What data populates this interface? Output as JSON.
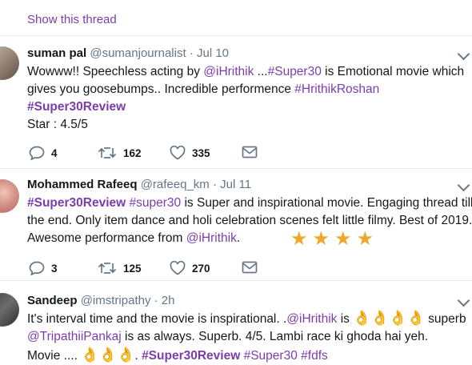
{
  "show_thread": "Show this thread",
  "tweets": [
    {
      "name": "suman pal",
      "handle": "@sumanjournalist",
      "sep": "·",
      "time": "Jul 10",
      "line1_a": "Wowww!! Speechless acting by ",
      "line1_mention": "@iHrithik",
      "line1_b": " ...",
      "line1_tag": "#Super30",
      "line1_c": " is Emotional movie which",
      "line2_a": "gives you goosebumps.. Incredible performence ",
      "line2_tag": "#HrithikRoshan",
      "line3_tag": "#Super30Review",
      "line4": "Star : 4.5/5",
      "replies": "4",
      "retweets": "162",
      "likes": "335"
    },
    {
      "name": "Mohammed Rafeeq",
      "handle": "@rafeeq_km",
      "sep": "·",
      "time": "Jul 11",
      "line1_tag1": "#Super30Review",
      "line1_tag2": "#super30",
      "line1_b": " is Super and inspirational movie. Engaging thread till",
      "line2": "the end. Only item dance and holi celebration scenes felt little filmy.  Best of 2019.",
      "line3_a": "Awesome performance from ",
      "line3_mention": "@iHrithik",
      "line3_b": ".",
      "stars": "★★★★",
      "replies": "3",
      "retweets": "125",
      "likes": "270"
    },
    {
      "name": "Sandeep",
      "handle": "@imstripathy",
      "sep": "·",
      "time": "2h",
      "line1_a": "It's interval time and the movie is inspirational. .",
      "line1_mention": "@iHrithik",
      "line1_b": " is ",
      "line1_emoji": "👌👌👌👌",
      "line1_c": " superb",
      "line2_mention": "@TripathiiPankaj",
      "line2_b": "  is as always. Superb. 4/5.  Lambi race ki ghoda hai yeh.",
      "line3_a": "Movie .... ",
      "line3_emoji": "👌👌👌",
      "line3_b": ". ",
      "line3_tag1": "#Super30Review",
      "line3_tag2": "#Super30",
      "line3_tag3": "#fdfs"
    }
  ],
  "colors": {
    "accent": "#7d3cae",
    "muted": "#657786",
    "star": "#f0a62a",
    "divider": "#e6ecf0"
  },
  "icons": [
    "reply-icon",
    "retweet-icon",
    "like-icon",
    "dm-icon",
    "chevron-down-icon"
  ]
}
